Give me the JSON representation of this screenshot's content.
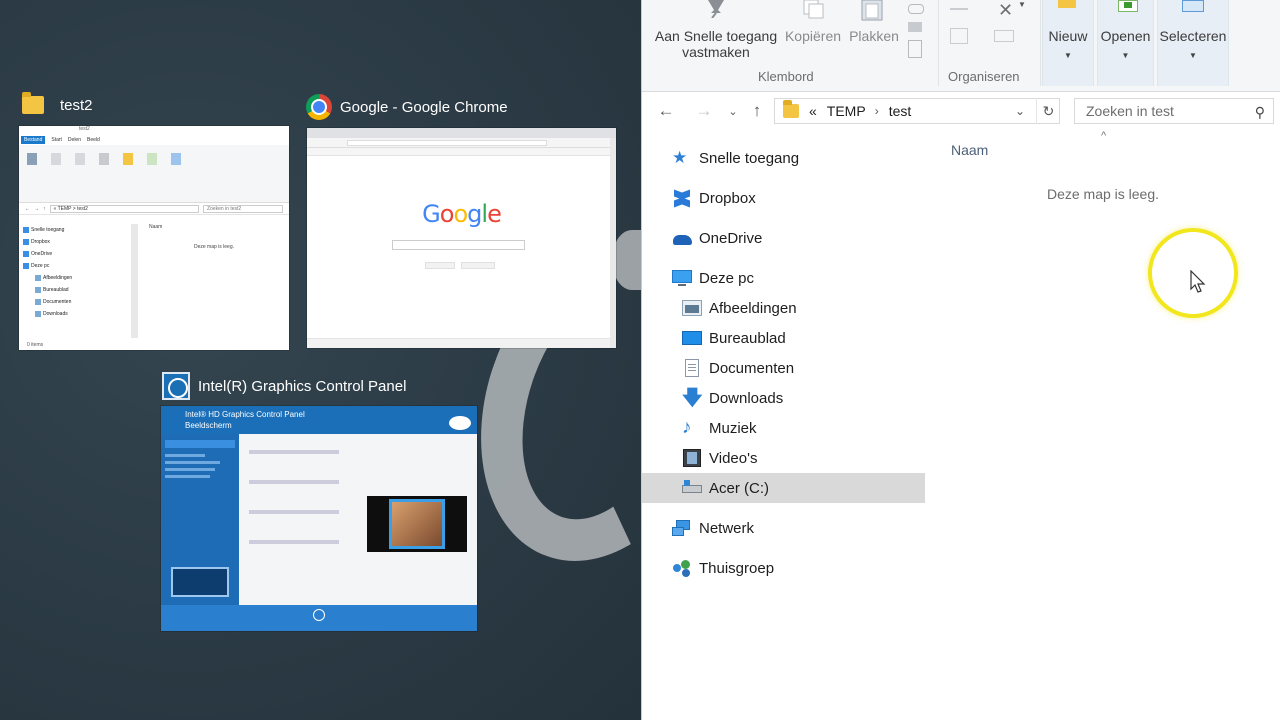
{
  "snap": {
    "windows": [
      {
        "title": "test2",
        "icon": "folder-icon",
        "mini": {
          "tabs": [
            "Bestand",
            "Start",
            "Delen",
            "Beeld"
          ],
          "address": "« TEMP > test2",
          "search": "Zoeken in test2",
          "nav": [
            "Snelle toegang",
            "Dropbox",
            "OneDrive",
            "Deze pc"
          ],
          "nav_sub": [
            "Afbeeldingen",
            "Bureaublad",
            "Documenten",
            "Downloads"
          ],
          "col": "Naam",
          "empty": "Deze map is leeg.",
          "status": "0 items"
        }
      },
      {
        "title": "Google - Google Chrome",
        "icon": "chrome-icon",
        "mini": {
          "logo": "Google"
        }
      },
      {
        "title": "Intel(R) Graphics Control Panel",
        "icon": "intel-icon",
        "mini": {
          "header": "Intel® HD Graphics Control Panel",
          "sub": "Beeldscherm"
        }
      }
    ]
  },
  "ribbon": {
    "pin_label_1": "Aan Snelle toegang",
    "pin_label_2": "vastmaken",
    "copy_label": "Kopiëren",
    "paste_label": "Plakken",
    "group_clipboard": "Klembord",
    "group_organize": "Organiseren",
    "new_label": "Nieuw",
    "open_label": "Openen",
    "select_label": "Selecteren"
  },
  "address": {
    "overflow": "«",
    "segments": [
      "TEMP",
      "test"
    ],
    "search_placeholder": "Zoeken in test"
  },
  "nav": {
    "quick_access": "Snelle toegang",
    "dropbox": "Dropbox",
    "onedrive": "OneDrive",
    "this_pc": "Deze pc",
    "pictures": "Afbeeldingen",
    "desktop": "Bureaublad",
    "documents": "Documenten",
    "downloads": "Downloads",
    "music": "Muziek",
    "videos": "Video's",
    "drive_c": "Acer (C:)",
    "network": "Netwerk",
    "homegroup": "Thuisgroep"
  },
  "content": {
    "column_name": "Naam",
    "empty_message": "Deze map is leeg."
  },
  "colors": {
    "accent": "#1979ca",
    "cursor_ring": "#f2e61c",
    "selected_row": "#d9d9d9"
  }
}
